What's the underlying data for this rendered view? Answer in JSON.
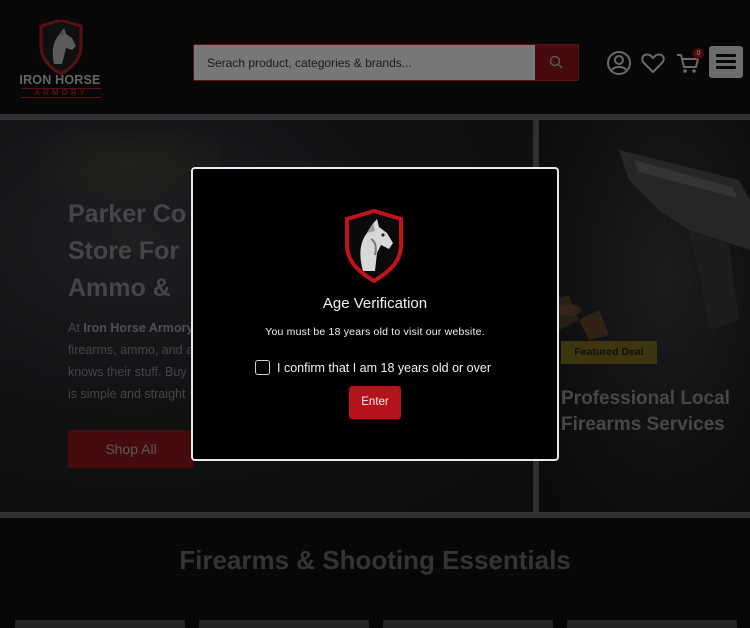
{
  "header": {
    "brand_name": "IRON HORSE",
    "brand_sub": "ARMORY",
    "search_placeholder": "Serach product, categories & brands...",
    "cart_count": "0"
  },
  "hero": {
    "title_lines": [
      "Parker Co",
      "Store For",
      "Ammo &"
    ],
    "intro_prefix": "At ",
    "intro_brand": "Iron Horse Armory",
    "text_lines": [
      "firearms, ammo, and a",
      "knows their stuff. Buy",
      "is simple and straight"
    ],
    "shop_button": "Shop All"
  },
  "promo": {
    "badge": "Featured Deal",
    "title_lines": [
      "Professional Local",
      "Firearms Services"
    ]
  },
  "section": {
    "title": "Firearms & Shooting Essentials"
  },
  "modal": {
    "title": "Age Verification",
    "subtitle": "You must be 18 years old to visit our website.",
    "confirm_label": "I confirm that I am 18 years old or over",
    "enter_button": "Enter"
  },
  "colors": {
    "accent_red": "#b5121b",
    "dark_red": "#6b1013",
    "badge_gold": "#5d5214",
    "background": "#0b0b0c"
  },
  "icons": {
    "search": "search-icon",
    "account": "user-icon",
    "wishlist": "heart-icon",
    "cart": "cart-icon",
    "menu": "hamburger-icon",
    "logo": "horse-shield-logo"
  }
}
